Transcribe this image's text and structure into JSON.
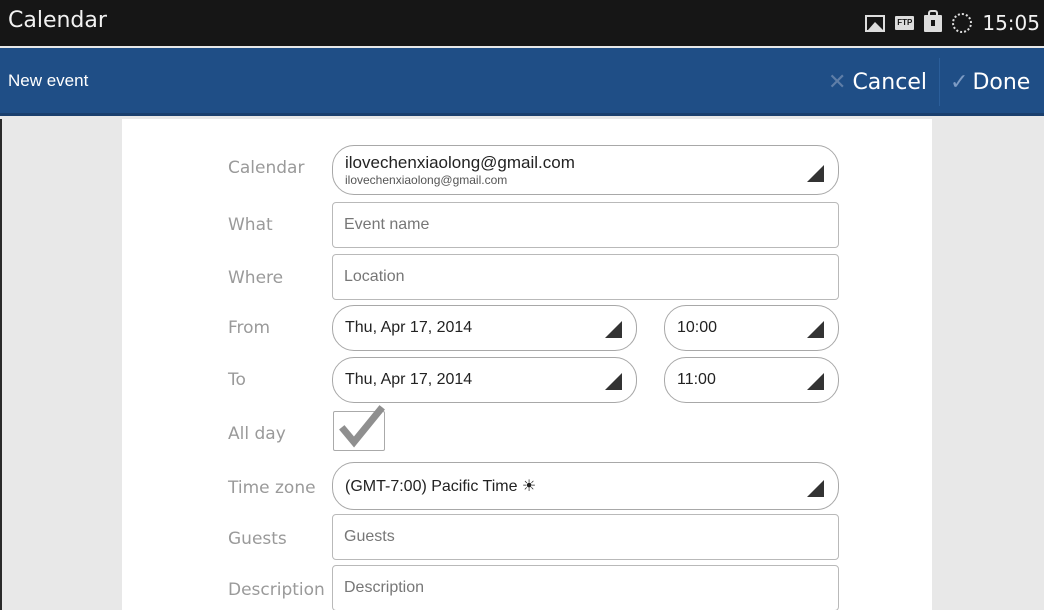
{
  "status_bar": {
    "app_title": "Calendar",
    "icons": [
      "image-icon",
      "ftp-icon",
      "bag-icon",
      "sync-icon"
    ],
    "ftp_label": "FTP",
    "clock": "15:05"
  },
  "action_bar": {
    "title": "New event",
    "cancel_label": "Cancel",
    "done_label": "Done",
    "background_color": "#1f4e86"
  },
  "form": {
    "calendar": {
      "label": "Calendar",
      "account_name": "ilovechenxiaolong@gmail.com",
      "account_email": "ilovechenxiaolong@gmail.com"
    },
    "what": {
      "label": "What",
      "placeholder": "Event name"
    },
    "where": {
      "label": "Where",
      "placeholder": "Location"
    },
    "from": {
      "label": "From",
      "date": "Thu, Apr 17, 2014",
      "time": "10:00"
    },
    "to": {
      "label": "To",
      "date": "Thu, Apr 17, 2014",
      "time": "11:00"
    },
    "all_day": {
      "label": "All day",
      "checked": true
    },
    "time_zone": {
      "label": "Time zone",
      "value": "(GMT-7:00) Pacific Time ☀"
    },
    "guests": {
      "label": "Guests",
      "placeholder": "Guests"
    },
    "description": {
      "label": "Description",
      "placeholder": "Description"
    }
  }
}
